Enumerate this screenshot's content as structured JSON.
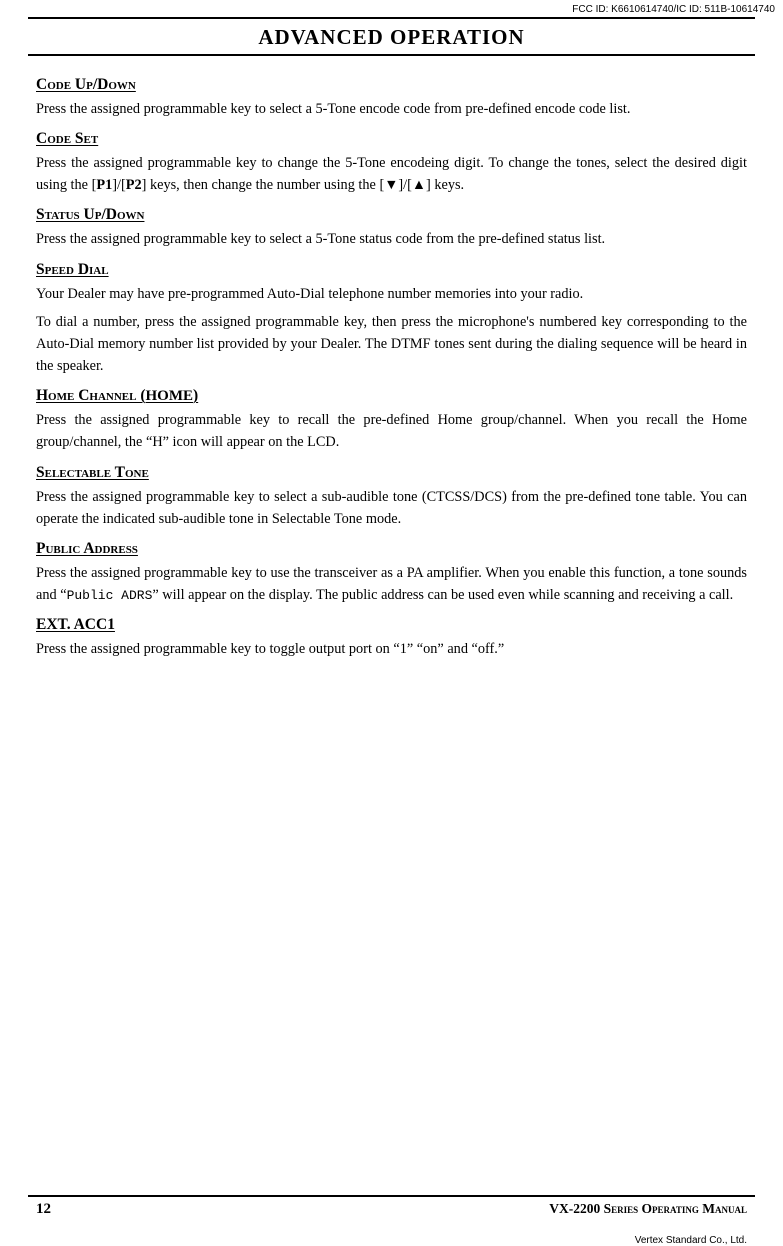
{
  "header": {
    "fcc": "FCC ID: K6610614740/IC ID: 511B-10614740"
  },
  "title": "Advanced Operation",
  "sections": [
    {
      "id": "code-up-down",
      "heading": "Code Up/Down",
      "body": [
        "Press the assigned programmable key to select a 5-Tone encode code from pre-defined encode code list."
      ]
    },
    {
      "id": "code-set",
      "heading": "Code Set",
      "body": [
        "Press the assigned programmable key to change the 5-Tone encodeing digit. To change the tones, select the desired digit using the [P1]/[P2] keys, then change the number using the [▼]/[▲] keys."
      ]
    },
    {
      "id": "status-up-down",
      "heading": "Status Up/Down",
      "body": [
        "Press the assigned programmable key to select a 5-Tone status code from the pre-defined status list."
      ]
    },
    {
      "id": "speed-dial",
      "heading": "Speed Dial",
      "body": [
        "Your Dealer may have pre-programmed Auto-Dial telephone number memories into your radio.",
        "To dial a number, press the assigned programmable key, then press the microphone's numbered key corresponding to the Auto-Dial memory number list provided by your Dealer. The DTMF tones sent during the dialing sequence will be heard in the speaker."
      ]
    },
    {
      "id": "home-channel",
      "heading": "Home Channel (HOME)",
      "body": [
        "Press the assigned programmable key to recall the pre-defined Home group/channel. When you recall the Home group/channel, the “H” icon will appear on the LCD."
      ]
    },
    {
      "id": "selectable-tone",
      "heading": "Selectable Tone",
      "body": [
        "Press the assigned programmable key to select a sub-audible tone (CTCSS/DCS) from the pre-defined tone table. You can operate the indicated sub-audible tone in Selectable Tone mode."
      ]
    },
    {
      "id": "public-address",
      "heading": "Public Address",
      "body": [
        "Press the assigned programmable key to use the transceiver as a PA amplifier. When you enable this function, a tone sounds and “Public ADRS” will appear on the display. The public address can be used even while scanning and receiving a call."
      ]
    },
    {
      "id": "ext-acc1",
      "heading": "EXT. ACC1",
      "type": "ext",
      "body": [
        "Press the assigned programmable key to toggle output port on “1” “on” and “off.”"
      ]
    }
  ],
  "footer": {
    "page_number": "12",
    "manual_title": "VX-2200 Series Operating Manual",
    "vertex": "Vertex Standard Co., Ltd."
  }
}
